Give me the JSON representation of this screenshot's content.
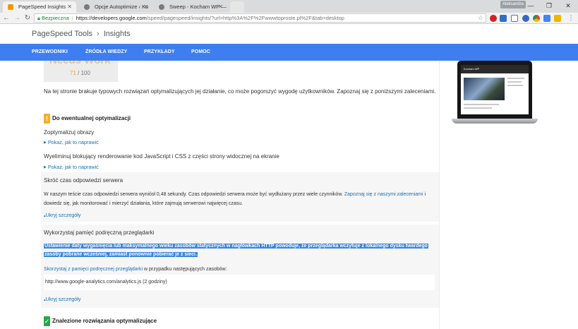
{
  "browser": {
    "tabs": [
      {
        "label": "PageSpeed Insights",
        "active": true,
        "favicon_color": "#f29900"
      },
      {
        "label": "Opcje Autoptimize ‹ Ko",
        "active": false,
        "favicon_color": "#7a7a7a"
      },
      {
        "label": "Sweep - Kocham WP —",
        "active": false,
        "favicon_color": "#7a7a7a"
      }
    ],
    "user_badge": "Aleksandra",
    "window_controls": {
      "minimize": "—",
      "maximize": "❐",
      "close": "✕"
    },
    "address": {
      "secure_label": "Bezpieczna",
      "url_host": "https://developers.google.com",
      "url_rest": "/speed/pagespeed/insights/?url=http%3A%2F%2Fwwwtoproste.pl%2F&tab=desktop"
    },
    "extension_icons": [
      "opera-icon",
      "mail-icon",
      "music-icon",
      "circle-icon",
      "chrome-icon",
      "shield-icon",
      "puzzle-icon",
      "menu-icon"
    ]
  },
  "header": {
    "brand": "PageSpeed Tools",
    "section": "Insights"
  },
  "nav": {
    "items": [
      "PRZEWODNIKI",
      "ŹRÓDŁA WIEDZY",
      "PRZYKŁADY",
      "POMOC"
    ]
  },
  "score": {
    "title": "Needs Work",
    "value": "71",
    "max": "/ 100"
  },
  "intro": "Na tej stronie brakuje typowych rozwiązań optymalizujących jej działanie, co może pogorszyć wygodę użytkowników. Zapoznaj się z poniższymi zaleceniami.",
  "sections": {
    "optional": {
      "badge": "!",
      "title": "Do ewentualnej optymalizacji"
    },
    "found": {
      "badge": "✓",
      "title": "Znalezione rozwiązania optymalizujące"
    }
  },
  "rules": [
    {
      "title": "Zoptymalizuj obrazy",
      "action": "Pokaż, jak to naprawić"
    },
    {
      "title": "Wyeliminuj blokujący renderowanie kod JavaScript i CSS z części strony widocznej na ekranie",
      "action": "Pokaż, jak to naprawić"
    }
  ],
  "server_panel": {
    "title": "Skróć czas odpowiedzi serwera",
    "text_before": "W naszym teście czas odpowiedzi serwera wyniósł 0,48 sekundy. Czas odpowiedzi serwera może być wydłużany przez wiele czynników. ",
    "link": "Zapoznaj się z naszymi zaleceniami",
    "text_after": " i dowiedz się, jak monitorować i mierzyć działania, które zajmują serwerowi najwięcej czasu.",
    "collapse": "Ukryj szczegóły"
  },
  "cache_panel": {
    "title": "Wykorzystaj pamięć podręczną przeglądarki",
    "highlight_line1": "Ustawienie daty wygaśnięcia lub maksymalnego wieku zasobów statycznych w nagłówkach HTTP powoduje, że przeglądarka wczytuje z lokalnego dysku twardego",
    "highlight_line2": "zasoby pobrane wcześniej, zamiast ponownie pobierać je z sieci.",
    "link": "Skorzystaj z pamięci podręcznej przeglądarki",
    "link_after": " w przypadku następujących zasobów:",
    "resource": "http://www.google-analytics.com/analytics.js (2 godziny)",
    "collapse": "Ukryj szczegóły"
  },
  "preview": {
    "site_title": "Kocham WP"
  },
  "colors": {
    "nav_blue": "#3f7ef0",
    "warn": "#f3b02b",
    "ok": "#27a74a",
    "link": "#1a6fb4",
    "highlight": "#3b84d8",
    "score": "#e8a23a"
  }
}
